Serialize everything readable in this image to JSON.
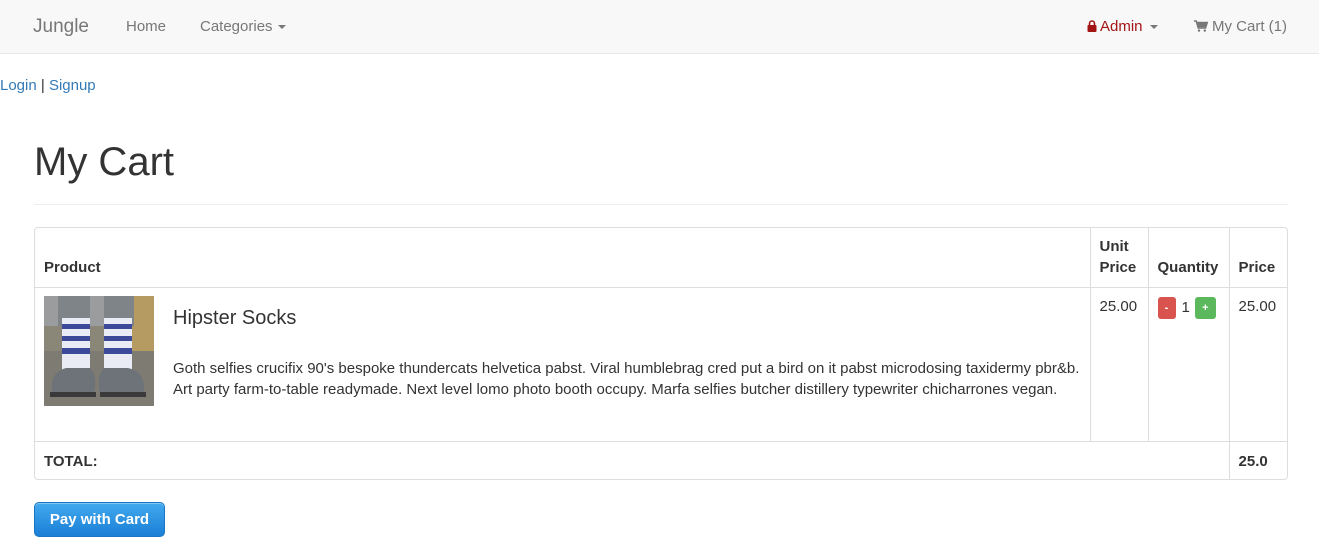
{
  "navbar": {
    "brand": "Jungle",
    "home": "Home",
    "categories": "Categories",
    "admin": "Admin",
    "cart": "My Cart (1)"
  },
  "auth": {
    "login": "Login",
    "separator": " | ",
    "signup": "Signup"
  },
  "page": {
    "title": "My Cart"
  },
  "table": {
    "headers": {
      "product": "Product",
      "unit_price_line1": "Unit",
      "unit_price_line2": "Price",
      "quantity": "Quantity",
      "price": "Price"
    },
    "items": [
      {
        "image": "hipster-socks-photo",
        "name": "Hipster Socks",
        "description": "Goth selfies crucifix 90's bespoke thundercats helvetica pabst. Viral humblebrag cred put a bird on it pabst microdosing taxidermy pbr&b. Art party farm-to-table readymade. Next level lomo photo booth occupy. Marfa selfies butcher distillery typewriter chicharrones vegan.",
        "unit_price": "25.00",
        "quantity": "1",
        "decrement_label": "-",
        "increment_label": "+",
        "price": "25.00"
      }
    ],
    "total_label": "TOTAL:",
    "total_value": "25.0"
  },
  "pay_button": "Pay with Card",
  "colors": {
    "link": "#337ab7",
    "admin": "#a31515",
    "minus_button": "#d9534f",
    "plus_button": "#5cb85c",
    "pay_button": "#2a8fe0"
  },
  "icons": {
    "admin": "lock-icon",
    "cart": "shopping-cart-icon",
    "dropdown": "caret-down-icon"
  }
}
